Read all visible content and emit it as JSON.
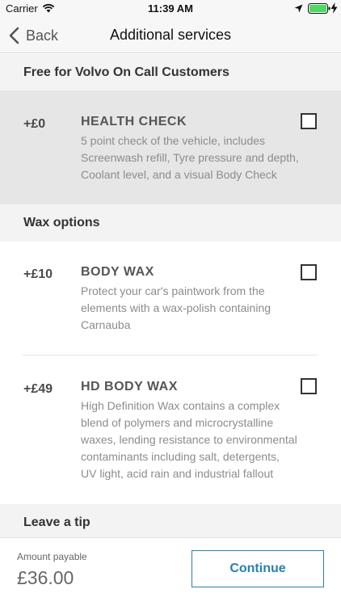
{
  "status_bar": {
    "carrier": "Carrier",
    "time": "11:39 AM"
  },
  "nav": {
    "back_label": "Back",
    "title": "Additional services"
  },
  "sections": {
    "free": "Free for Volvo On Call Customers",
    "wax": "Wax options",
    "tip": "Leave a tip"
  },
  "services": [
    {
      "price": "+£0",
      "name": "HEALTH CHECK",
      "description": [
        "5 point check of the vehicle, includes",
        "Screenwash refill, Tyre pressure and depth,",
        "Coolant level, and a visual Body Check"
      ],
      "checked": false
    },
    {
      "price": "+£10",
      "name": "BODY WAX",
      "description": [
        "Protect your car's paintwork from the",
        "elements with a wax-polish containing",
        "Carnauba"
      ],
      "checked": false
    },
    {
      "price": "+£49",
      "name": "HD BODY WAX",
      "description": [
        "High Definition Wax contains a complex",
        "blend of polymers and microcrystalline",
        "waxes, lending resistance to environmental",
        "contaminants including salt, detergents,",
        "UV light, acid rain and industrial fallout"
      ],
      "checked": false
    }
  ],
  "footer": {
    "amount_label": "Amount payable",
    "amount_value": "£36.00",
    "continue_label": "Continue"
  },
  "colors": {
    "accent": "#2a7fae",
    "highlight_row": "#e6e6e6",
    "battery": "#4cd964"
  }
}
